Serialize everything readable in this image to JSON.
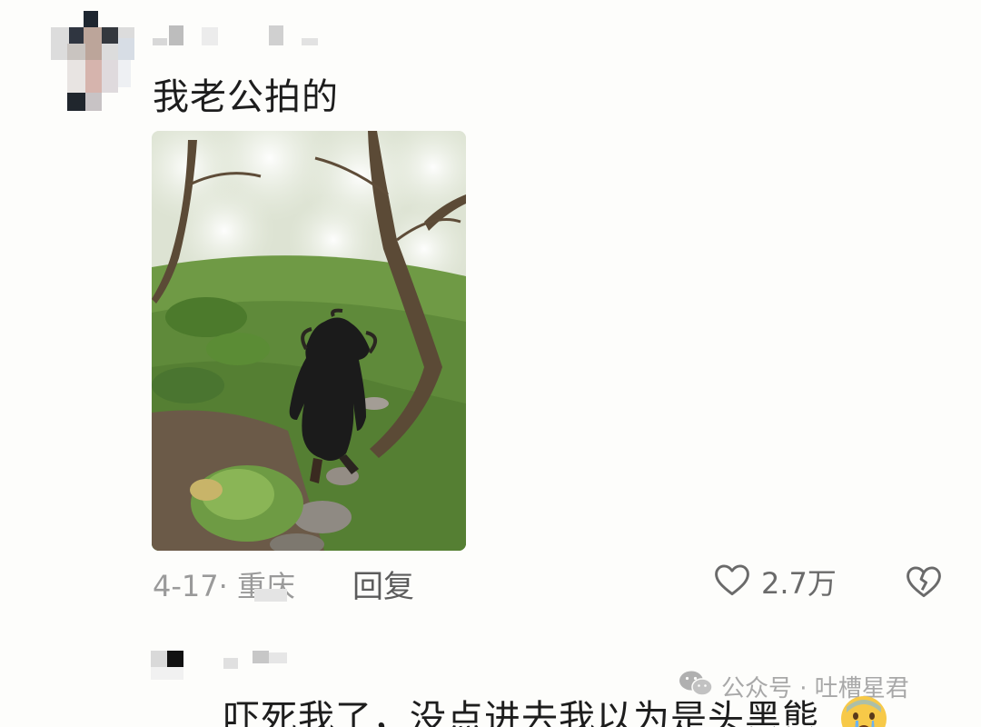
{
  "comment": {
    "text": "我老公拍的",
    "date_location": "4-17· 重庆",
    "reply_label": "回复",
    "like_count": "2.7万",
    "photo_alt": "照片"
  },
  "reply": {
    "text": "吓死我了，没点进去我以为是头黑熊"
  },
  "watermark": {
    "text": "公众号 · 吐槽星君"
  },
  "icons": {
    "like": "heart-outline-icon",
    "dislike": "broken-heart-icon",
    "watermark": "wechat-icon",
    "emoji": "crying-face-emoji"
  },
  "colors": {
    "text_primary": "#1d1d1d",
    "text_secondary": "#9a9a9a",
    "background": "#fdfdfb"
  }
}
